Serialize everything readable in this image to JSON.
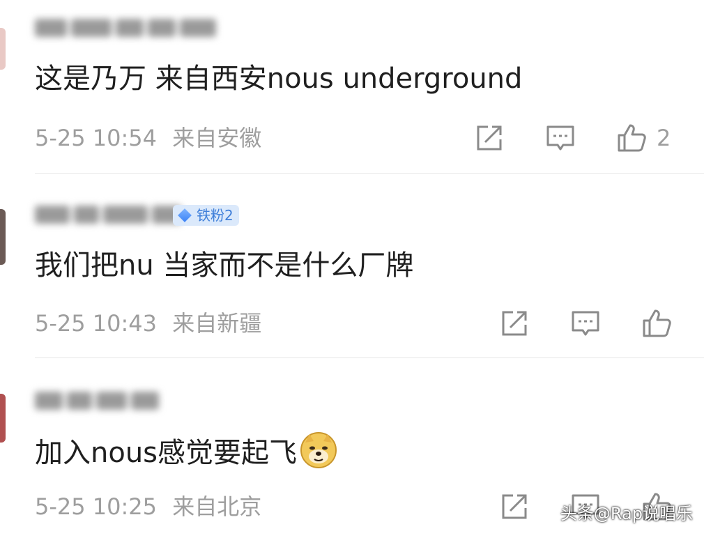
{
  "comments": [
    {
      "text": "这是乃万 来自西安nous underground",
      "time": "5-25 10:54",
      "location": "来自安徽",
      "like_count": "2",
      "badge": ""
    },
    {
      "text": "我们把nu 当家而不是什么厂牌",
      "time": "5-25 10:43",
      "location": "来自新疆",
      "like_count": "",
      "badge": "铁粉2"
    },
    {
      "text": "加入nous感觉要起飞",
      "time": "5-25 10:25",
      "location": "来自北京",
      "like_count": "",
      "badge": "",
      "emoji": "doge-emoji"
    }
  ],
  "icons": {
    "share": "share-icon",
    "reply": "comment-icon",
    "like": "thumbs-up-icon"
  },
  "colors": {
    "text": "#1f1f1f",
    "meta": "#9e9e9e",
    "icon": "#8a8a8a",
    "badge_bg": "#dbe9fb",
    "badge_text": "#3f7fd9"
  },
  "watermark": "头条@Rap说唱乐"
}
